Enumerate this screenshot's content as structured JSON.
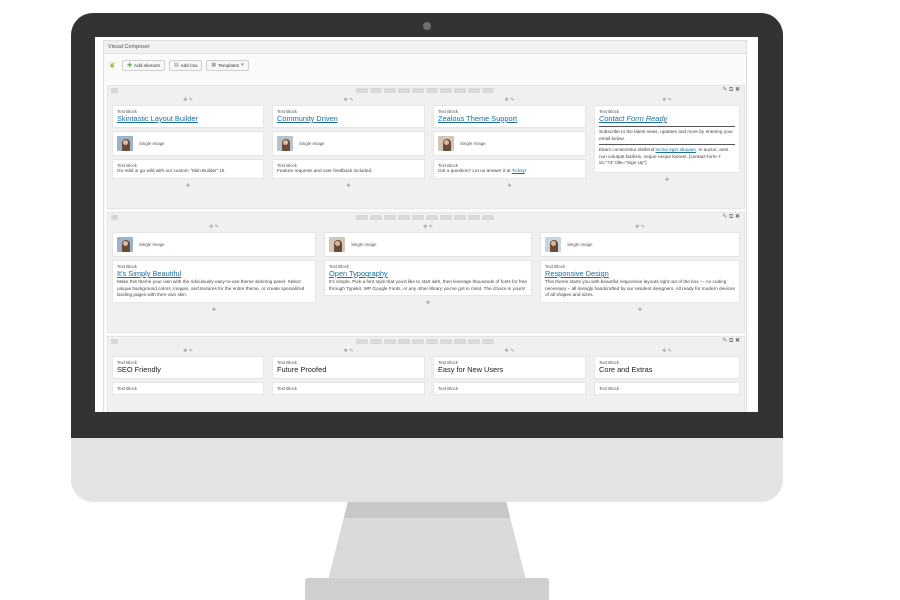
{
  "window": {
    "title": "Visual Composer"
  },
  "toolbar": {
    "add_element": "Add element",
    "add_row": "Add row",
    "templates": "Templates",
    "templates_caret": "▾"
  },
  "icons": {
    "move": "✥ ✎",
    "drag": "✥",
    "row_controls": "✎ ⧉ ✖",
    "logo": "❦"
  },
  "rows": [
    {
      "columns": [
        {
          "text_type": "Text Block",
          "heading": "Skintastic Layout Builder",
          "image_label": "Single Image",
          "body_type": "Text Block",
          "body": "Go mild or go wild with our custom \"Skin Builder\" UI."
        },
        {
          "text_type": "Text Block",
          "heading": "Community Driven",
          "image_label": "Single Image",
          "body_type": "Text Block",
          "body": "Feature requests and user feedback included."
        },
        {
          "text_type": "Text Block",
          "heading": "Zealous Theme Support",
          "image_label": "Single Image",
          "body_type": "Text Block",
          "body_pre": "Got a question? Let us answer it at ",
          "body_link": "Ticksy",
          "body_post": "!"
        },
        {
          "text_type": "Text Block",
          "heading": "Contact Form Ready",
          "body1": "Subscribe to the latest news, updates and more by entering your email below.",
          "body2_pre": "Etiam consectetur eleifend ",
          "body2_link": "lectus eget aliquam",
          "body2_post": ". In auctor, ante non volutpat facilisis, neque neque laoreet. [contact-form-7 id=\"74\" title=\"Sign Up\"]"
        }
      ]
    },
    {
      "columns": [
        {
          "image_label": "Single Image",
          "text_type": "Text Block",
          "heading": "It's Simply Beautiful",
          "body": "Make this theme your own with the ridiculously easy-to-use theme skinning panel. Select unique background colors, images, and textures for the entire theme, or create specialized landing pages with their own skin."
        },
        {
          "image_label": "Single Image",
          "text_type": "Text Block",
          "heading": "Open Typography",
          "body": "It's simple. Pick a font style that you'd like to start with, then leverage thousands of fonts for free through Typekit, WP Google Fonts, or any other library you've got in mind. The choice is yours!"
        },
        {
          "image_label": "Single Image",
          "text_type": "Text Block",
          "heading": "Responsive Design",
          "body": "This theme starts you with beautiful responsive layouts right out of the box — no coding necessary – all lovingly handcrafted by our resident designers. All ready for modern devices of all shapes and sizes."
        }
      ]
    },
    {
      "columns": [
        {
          "text_type": "Text Block",
          "heading": "SEO Friendly",
          "body_type": "Text Block"
        },
        {
          "text_type": "Text Block",
          "heading": "Future Proofed",
          "body_type": "Text Block"
        },
        {
          "text_type": "Text Block",
          "heading": "Easy for New Users",
          "body_type": "Text Block"
        },
        {
          "text_type": "Text Block",
          "heading": "Core and Extras",
          "body_type": "Text Block"
        }
      ]
    }
  ]
}
